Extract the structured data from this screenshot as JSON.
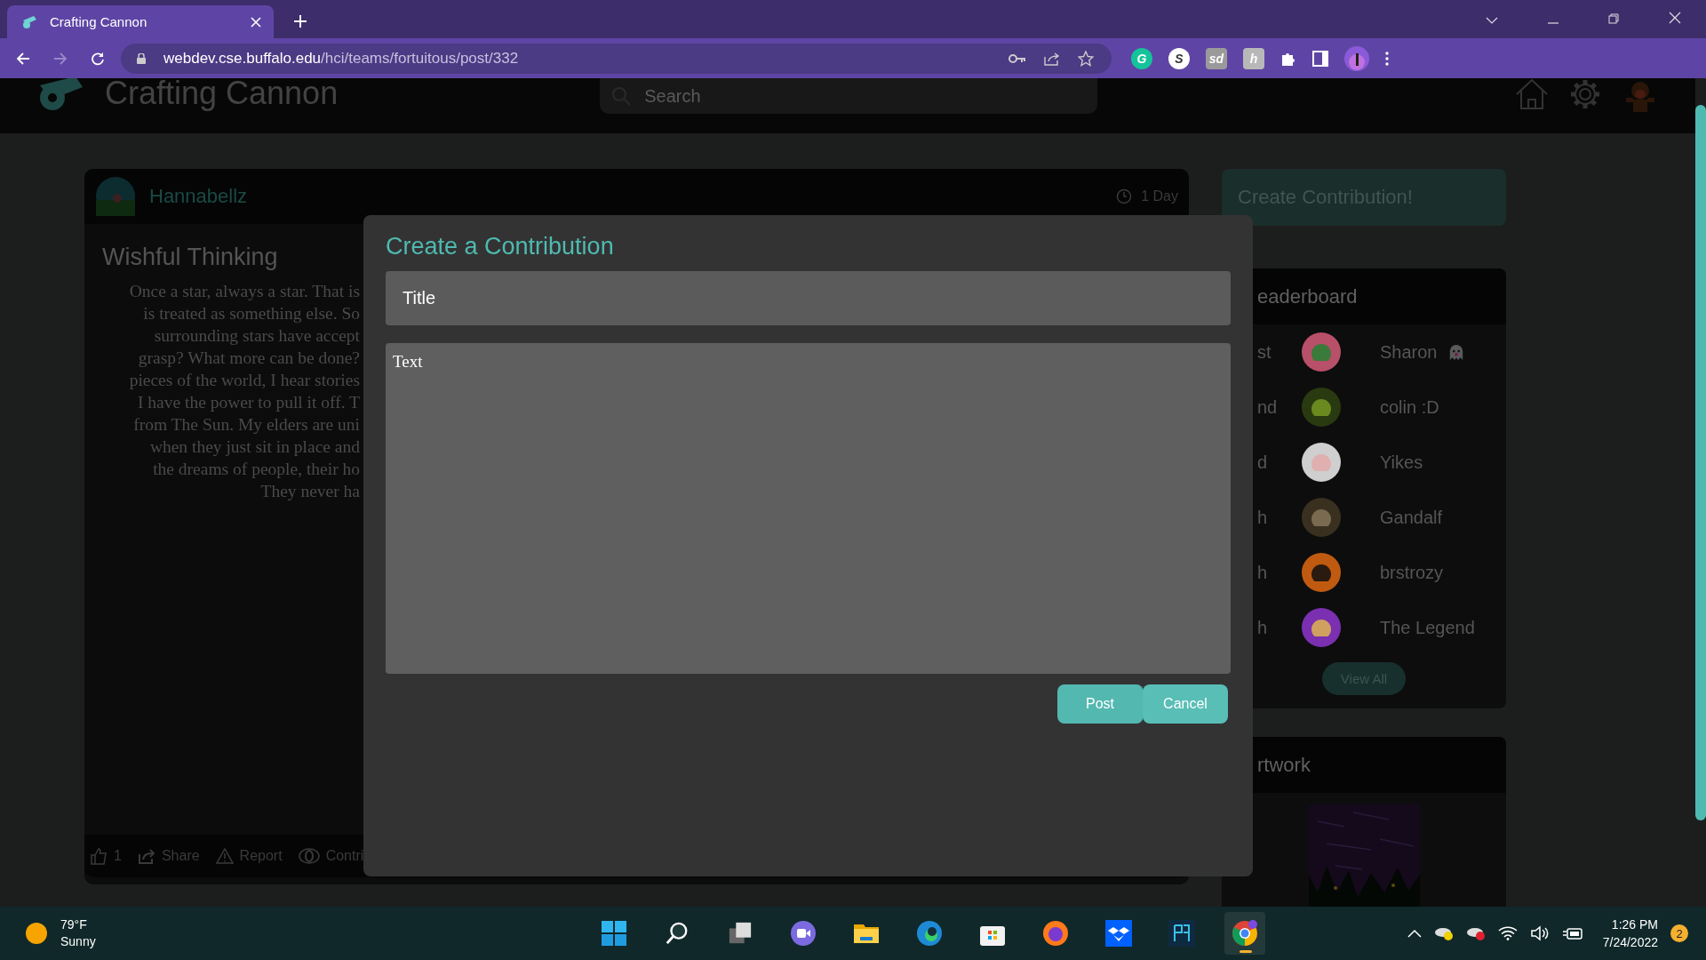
{
  "browser": {
    "tab_title": "Crafting Cannon",
    "url_host": "webdev.cse.buffalo.edu",
    "url_path": "/hci/teams/fortuitous/post/332",
    "extensions": [
      {
        "label": "G",
        "kind": "round",
        "color": "#15c39a"
      },
      {
        "label": "S",
        "kind": "round",
        "color": "#ffffff"
      },
      {
        "label": "sd",
        "kind": "square",
        "color": "#9a9a9a"
      },
      {
        "label": "h",
        "kind": "square",
        "color": "#b8b8b8"
      }
    ]
  },
  "site": {
    "name": "Crafting Cannon",
    "search": {
      "placeholder": "Search"
    }
  },
  "post": {
    "author": "Hannabellz",
    "age": "1 Day",
    "title": "Wishful Thinking",
    "body_lines": [
      "Once a star, always a star. That is",
      "is treated as something else. So",
      "surrounding stars have accept",
      "grasp? What more can be done?",
      "pieces of the world, I hear stories",
      "I have the power to pull it off. T",
      "from The Sun. My elders are uni",
      "when they just sit in place and",
      "the dreams of people, their ho",
      "They never ha"
    ],
    "actions": [
      {
        "label": "1",
        "kind": "like"
      },
      {
        "label": "Share",
        "kind": "share"
      },
      {
        "label": "Report",
        "kind": "report"
      },
      {
        "label": "Contri",
        "kind": "contribute"
      }
    ]
  },
  "sidebar": {
    "create_button": "Create Contribution!",
    "leaderboard": {
      "title": "eaderboard",
      "view_all": "View All",
      "rows": [
        {
          "rank": "st",
          "name": "Sharon",
          "ghost": true
        },
        {
          "rank": "nd",
          "name": "colin :D"
        },
        {
          "rank": "d",
          "name": "Yikes"
        },
        {
          "rank": "h",
          "name": "Gandalf"
        },
        {
          "rank": "h",
          "name": "brstrozy"
        },
        {
          "rank": "h",
          "name": "The Legend"
        }
      ]
    },
    "artwork": {
      "title": "rtwork"
    }
  },
  "modal": {
    "title": "Create a Contribution",
    "title_field": {
      "placeholder": "Title"
    },
    "text_field": {
      "placeholder": "Text"
    },
    "buttons": [
      {
        "label": "Post",
        "kind": "post"
      },
      {
        "label": "Cancel",
        "kind": "cancel"
      }
    ]
  },
  "taskbar": {
    "weather": {
      "temp": "79°F",
      "condition": "Sunny"
    },
    "apps": [
      {
        "kind": "start",
        "active": false
      },
      {
        "kind": "search",
        "active": false
      },
      {
        "kind": "taskview",
        "active": false
      },
      {
        "kind": "chat",
        "active": false
      },
      {
        "kind": "explorer",
        "active": false
      },
      {
        "kind": "edge",
        "active": false
      },
      {
        "kind": "store",
        "active": false
      },
      {
        "kind": "firefox",
        "active": false
      },
      {
        "kind": "dropbox",
        "active": false
      },
      {
        "kind": "app",
        "active": false
      },
      {
        "kind": "chrome",
        "active": true
      }
    ],
    "time": "1:26 PM",
    "date": "7/24/2022",
    "notifications": "2"
  }
}
